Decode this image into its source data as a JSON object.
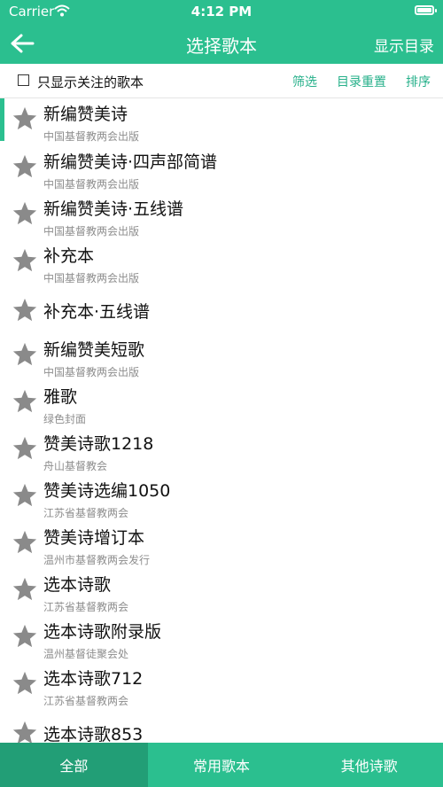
{
  "status": {
    "carrier": "Carrier",
    "time": "4:12 PM"
  },
  "nav": {
    "title": "选择歌本",
    "action": "显示目录"
  },
  "filter": {
    "label": "只显示关注的歌本",
    "actions": [
      "筛选",
      "目录重置",
      "排序"
    ]
  },
  "colors": {
    "accent": "#2bbf8f",
    "accent_dark": "#229e76",
    "star": "#8a8a8a",
    "subtext": "#8e8e8e"
  },
  "items": [
    {
      "name": "新编赞美诗",
      "sub": "中国基督教两会出版"
    },
    {
      "name": "新编赞美诗·四声部简谱",
      "sub": "中国基督教两会出版"
    },
    {
      "name": "新编赞美诗·五线谱",
      "sub": "中国基督教两会出版"
    },
    {
      "name": "补充本",
      "sub": "中国基督教两会出版"
    },
    {
      "name": "补充本·五线谱",
      "sub": ""
    },
    {
      "name": "新编赞美短歌",
      "sub": "中国基督教两会出版"
    },
    {
      "name": "雅歌",
      "sub": "绿色封面"
    },
    {
      "name": "赞美诗歌1218",
      "sub": "舟山基督教会"
    },
    {
      "name": "赞美诗选编1050",
      "sub": "江苏省基督教两会"
    },
    {
      "name": "赞美诗增订本",
      "sub": "温州市基督教两会发行"
    },
    {
      "name": "选本诗歌",
      "sub": "江苏省基督教两会"
    },
    {
      "name": "选本诗歌附录版",
      "sub": "温州基督徒聚会处"
    },
    {
      "name": "选本诗歌712",
      "sub": "江苏省基督教两会"
    },
    {
      "name": "选本诗歌853",
      "sub": ""
    }
  ],
  "tabs": [
    {
      "label": "全部",
      "active": true
    },
    {
      "label": "常用歌本",
      "active": false
    },
    {
      "label": "其他诗歌",
      "active": false
    }
  ]
}
